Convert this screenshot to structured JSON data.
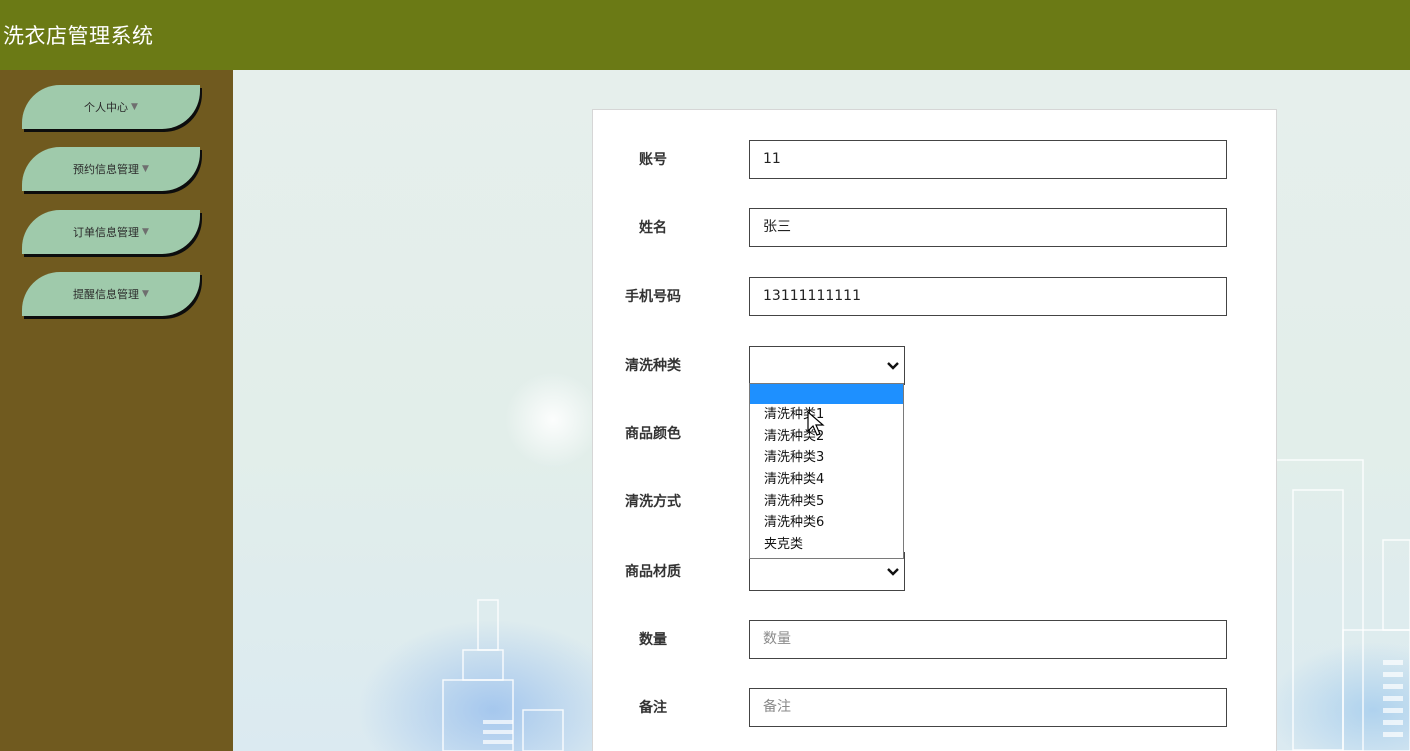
{
  "app": {
    "title": "洗衣店管理系统"
  },
  "sidebar": {
    "items": [
      {
        "label": "个人中心"
      },
      {
        "label": "预约信息管理"
      },
      {
        "label": "订单信息管理"
      },
      {
        "label": "提醒信息管理"
      }
    ],
    "caret": "▼"
  },
  "form": {
    "account": {
      "label": "账号",
      "value": "11"
    },
    "name": {
      "label": "姓名",
      "value": "张三"
    },
    "phone": {
      "label": "手机号码",
      "value": "13111111111"
    },
    "wash_type": {
      "label": "清洗种类",
      "value": "",
      "options": [
        "",
        "清洗种类1",
        "清洗种类2",
        "清洗种类3",
        "清洗种类4",
        "清洗种类5",
        "清洗种类6",
        "夹克类"
      ]
    },
    "color": {
      "label": "商品颜色"
    },
    "wash_method": {
      "label": "清洗方式"
    },
    "material": {
      "label": "商品材质",
      "value": ""
    },
    "quantity": {
      "label": "数量",
      "placeholder": "数量"
    },
    "remark": {
      "label": "备注",
      "placeholder": "备注"
    }
  },
  "colors": {
    "header": "#6b7a15",
    "sidebar": "#705a1f",
    "menu_item": "#9fcaab",
    "selected_option": "#1e90ff"
  }
}
